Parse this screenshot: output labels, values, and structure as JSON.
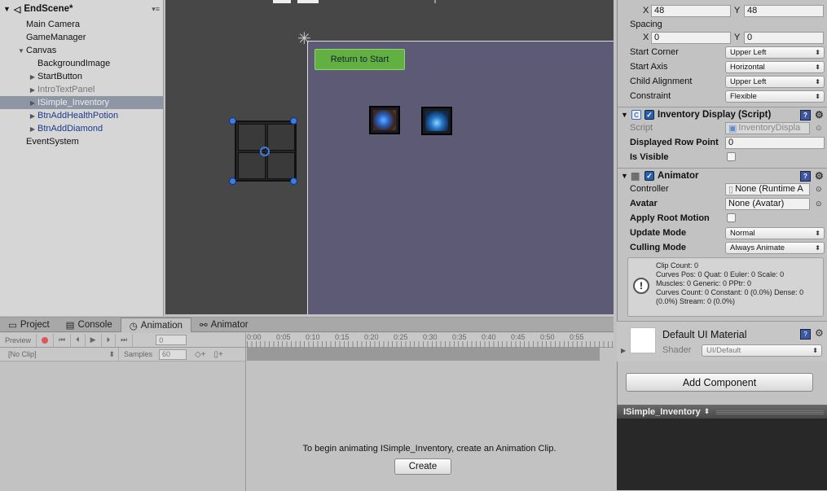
{
  "hierarchy": {
    "scene_name": "EndScene*",
    "items": [
      {
        "label": "Main Camera"
      },
      {
        "label": "GameManager"
      },
      {
        "label": "Canvas"
      },
      {
        "label": "BackgroundImage"
      },
      {
        "label": "StartButton"
      },
      {
        "label": "IntroTextPanel"
      },
      {
        "label": "ISimple_Inventory"
      },
      {
        "label": "BtnAddHealthPotion"
      },
      {
        "label": "BtnAddDiamond"
      },
      {
        "label": "EventSystem"
      }
    ]
  },
  "scene": {
    "start_button_label": "Return to Start"
  },
  "bottom": {
    "tabs": [
      "Project",
      "Console",
      "Animation",
      "Animator"
    ],
    "preview_label": "Preview",
    "frame_value": "0",
    "clip_select": "[No Clip]",
    "samples_label": "Samples",
    "samples_value": "60",
    "time_ticks": [
      "0:00",
      "0:05",
      "0:10",
      "0:15",
      "0:20",
      "0:25",
      "0:30",
      "0:35",
      "0:40",
      "0:45",
      "0:50",
      "0:55"
    ],
    "message": "To begin animating ISimple_Inventory, create an Animation Clip.",
    "create_label": "Create"
  },
  "inspector": {
    "x_label": "X",
    "x_value": "48",
    "y_label": "Y",
    "y_value": "48",
    "spacing_label": "Spacing",
    "sx_value": "0",
    "sy_value": "0",
    "start_corner_label": "Start Corner",
    "start_corner_value": "Upper Left",
    "start_axis_label": "Start Axis",
    "start_axis_value": "Horizontal",
    "child_alignment_label": "Child Alignment",
    "child_alignment_value": "Upper Left",
    "constraint_label": "Constraint",
    "constraint_value": "Flexible",
    "inv_display_title": "Inventory Display (Script)",
    "script_label": "Script",
    "script_value": "InventoryDispla",
    "displayed_row_label": "Displayed Row Point",
    "displayed_row_value": "0",
    "is_visible_label": "Is Visible",
    "animator_title": "Animator",
    "controller_label": "Controller",
    "controller_value": "None (Runtime A",
    "avatar_label": "Avatar",
    "avatar_value": "None (Avatar)",
    "apply_root_label": "Apply Root Motion",
    "update_mode_label": "Update Mode",
    "update_mode_value": "Normal",
    "culling_mode_label": "Culling Mode",
    "culling_mode_value": "Always Animate",
    "info_lines": [
      "Clip Count: 0",
      "Curves Pos: 0 Quat: 0 Euler: 0 Scale: 0",
      "Muscles: 0 Generic: 0 PPtr: 0",
      "Curves Count: 0 Constant: 0 (0.0%) Dense: 0",
      "(0.0%) Stream: 0 (0.0%)"
    ],
    "material_title": "Default UI Material",
    "shader_label": "Shader",
    "shader_value": "UI/Default",
    "add_component_label": "Add Component",
    "preview_title": "ISimple_Inventory"
  }
}
